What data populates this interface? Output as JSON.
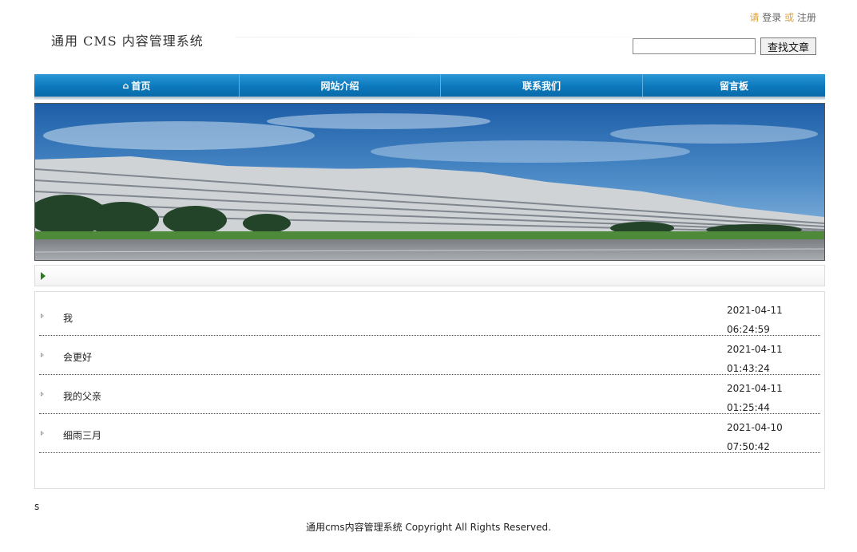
{
  "auth": {
    "please": "请",
    "login": "登录",
    "or": "或",
    "register": "注册"
  },
  "site": {
    "title": "通用 CMS 内容管理系统"
  },
  "search": {
    "placeholder": "",
    "button": "查找文章"
  },
  "nav": {
    "items": [
      "首页",
      "网站介绍",
      "联系我们",
      "留言板"
    ]
  },
  "colors": {
    "nav": "#0c79bd",
    "accent": "#d9a33a",
    "crumb_arrow": "#2a7a1e"
  },
  "articles": [
    {
      "title": "我",
      "date": "2021-04-11",
      "time": "06:24:59"
    },
    {
      "title": "会更好",
      "date": "2021-04-11",
      "time": "01:43:24"
    },
    {
      "title": "我的父亲",
      "date": "2021-04-11",
      "time": "01:25:44"
    },
    {
      "title": "细雨三月",
      "date": "2021-04-10",
      "time": "07:50:42"
    }
  ],
  "stray_text": "s",
  "footer": "通用cms内容管理系统 Copyright All Rights Reserved."
}
